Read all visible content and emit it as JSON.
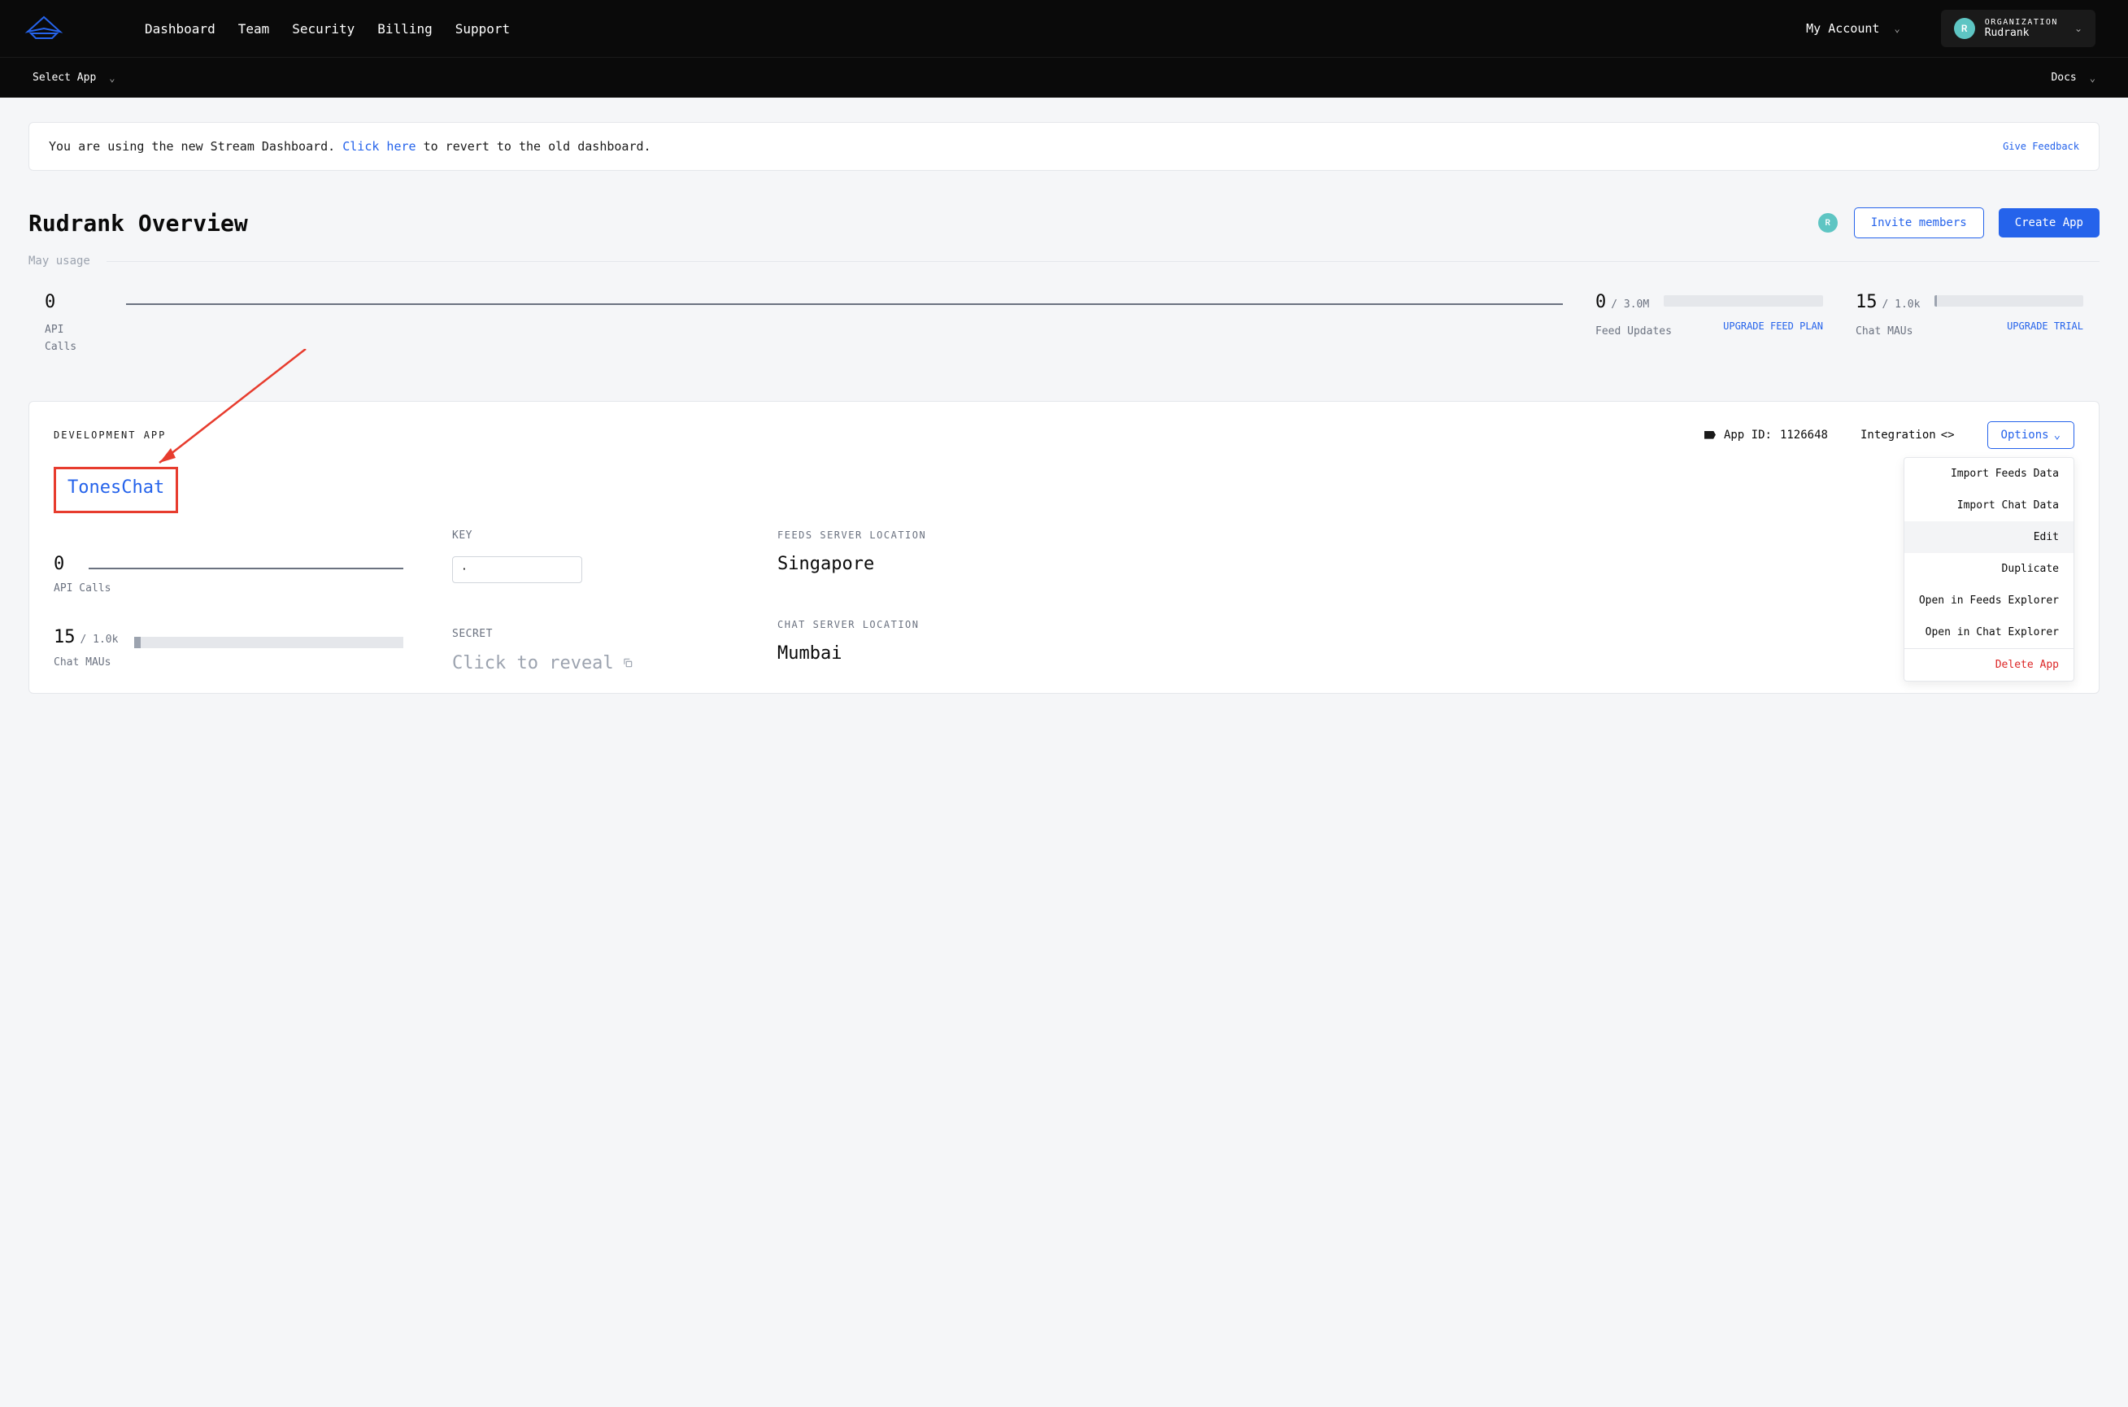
{
  "nav": {
    "items": [
      "Dashboard",
      "Team",
      "Security",
      "Billing",
      "Support"
    ],
    "my_account": "My Account",
    "org_label": "ORGANIZATION",
    "org_name": "Rudrank",
    "avatar_initial": "R",
    "select_app": "Select App",
    "docs": "Docs"
  },
  "banner": {
    "text_before": "You are using the new Stream Dashboard. ",
    "link": "Click here",
    "text_after": " to revert to the old dashboard.",
    "feedback": "Give Feedback"
  },
  "overview": {
    "title": "Rudrank Overview",
    "avatar_initial": "R",
    "invite": "Invite members",
    "create": "Create App",
    "usage_label": "May usage"
  },
  "metrics": {
    "api_calls": {
      "value": "0",
      "label": "API Calls"
    },
    "feed_updates": {
      "value": "0",
      "max": "/ 3.0M",
      "label": "Feed Updates",
      "upgrade": "UPGRADE FEED PLAN"
    },
    "chat_maus": {
      "value": "15",
      "max": "/ 1.0k",
      "label": "Chat MAUs",
      "upgrade": "UPGRADE TRIAL"
    }
  },
  "app": {
    "type_label": "DEVELOPMENT APP",
    "id_label": "App ID:",
    "id_value": "1126648",
    "integration": "Integration",
    "options_label": "Options",
    "name": "TonesChat",
    "api_calls": {
      "value": "0",
      "label": "API Calls"
    },
    "chat_maus": {
      "value": "15",
      "max": "/ 1.0k",
      "label": "Chat MAUs"
    },
    "key_label": "KEY",
    "key_value": "·",
    "secret_label": "SECRET",
    "reveal": "Click to reveal",
    "feeds_loc_label": "FEEDS SERVER LOCATION",
    "feeds_loc_val": "Singapore",
    "chat_loc_label": "CHAT SERVER LOCATION",
    "chat_loc_val": "Mumbai"
  },
  "dropdown": {
    "items": [
      "Import Feeds Data",
      "Import Chat Data",
      "Edit",
      "Duplicate",
      "Open in Feeds Explorer",
      "Open in Chat Explorer"
    ],
    "highlight_index": 2,
    "delete": "Delete App"
  }
}
